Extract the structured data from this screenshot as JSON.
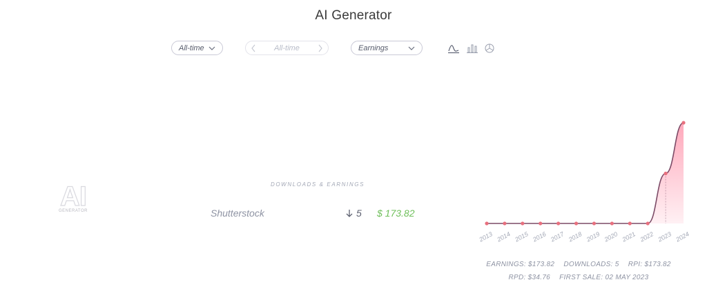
{
  "header": {
    "title": "AI Generator"
  },
  "filters": {
    "period": {
      "value": "All-time",
      "icon": "chevron-down-icon"
    },
    "range": {
      "value": "All-time",
      "prev_icon": "chevron-left-icon",
      "next_icon": "chevron-right-icon"
    },
    "metric": {
      "value": "Earnings",
      "icon": "chevron-down-icon"
    }
  },
  "view_icons": [
    "line-chart-icon",
    "bar-chart-icon",
    "pie-chart-icon"
  ],
  "logo": {
    "big": "AI",
    "small": "GENERATOR"
  },
  "section": {
    "label": "DOWNLOADS & EARNINGS"
  },
  "sources": [
    {
      "name": "Shutterstock",
      "downloads": "5",
      "earnings": "$ 173.82"
    }
  ],
  "stats": {
    "earnings": "EARNINGS: $173.82",
    "downloads": "DOWNLOADS: 5",
    "rpi": "RPI: $173.82",
    "rpd": "RPD: $34.76",
    "first_sale": "FIRST SALE: 02 MAY 2023"
  },
  "colors": {
    "line": "#7b4a66",
    "fill": "#ff9fb4",
    "point": "#e8707e",
    "earnings": "#6fbf5b"
  },
  "chart_data": {
    "type": "area",
    "categories": [
      "2013",
      "2014",
      "2015",
      "2016",
      "2017",
      "2018",
      "2019",
      "2020",
      "2021",
      "2022",
      "2023",
      "2024"
    ],
    "values": [
      0,
      0,
      0,
      0,
      0,
      0,
      0,
      0,
      0,
      0,
      72,
      145
    ],
    "ylim": [
      0,
      145
    ],
    "grid": false,
    "legend": "none"
  }
}
